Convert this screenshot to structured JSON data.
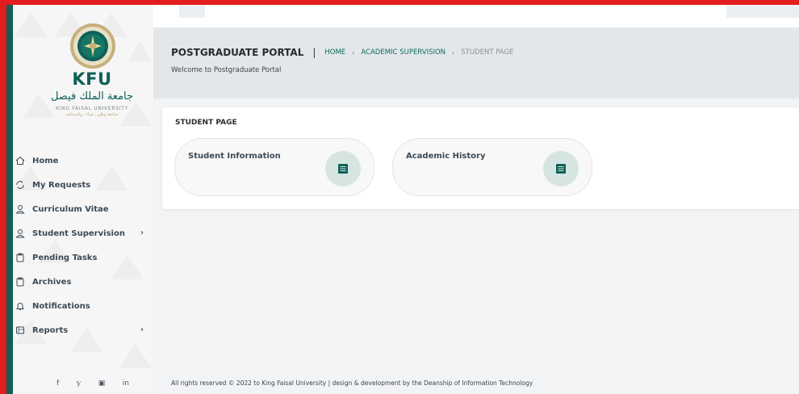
{
  "sidebar": {
    "logo": {
      "abbr": "KFU",
      "arabic_name": "جامعة الملك فيصل",
      "english_name": "KING FAISAL UNIVERSITY",
      "motto": "جـامعة وطن ـ نمـاء ـ واسـتدامة"
    },
    "items": [
      {
        "label": "Home",
        "icon": "home-icon"
      },
      {
        "label": "My Requests",
        "icon": "refresh-icon"
      },
      {
        "label": "Curriculum Vitae",
        "icon": "user-icon"
      },
      {
        "label": "Student Supervision",
        "icon": "user-icon",
        "chevron": "›"
      },
      {
        "label": "Pending Tasks",
        "icon": "clipboard-icon"
      },
      {
        "label": "Archives",
        "icon": "clipboard-icon"
      },
      {
        "label": "Notifications",
        "icon": "bell-icon"
      },
      {
        "label": "Reports",
        "icon": "report-icon",
        "chevron": "›"
      }
    ],
    "social": {
      "facebook": "f",
      "twitter": "𝕪",
      "youtube": "▣",
      "linkedin": "in"
    }
  },
  "header": {
    "title": "POSTGRADUATE PORTAL",
    "separator": "|",
    "breadcrumb": {
      "home": "HOME",
      "arrow": "›",
      "section": "ACADEMIC SUPERVISION",
      "current": "STUDENT PAGE"
    },
    "welcome": "Welcome to Postgraduate Portal"
  },
  "card": {
    "title": "STUDENT PAGE",
    "tiles": [
      {
        "label": "Student Information",
        "icon": "list-icon"
      },
      {
        "label": "Academic History",
        "icon": "list-icon"
      }
    ]
  },
  "footer": {
    "text": "All rights reserved © 2022 to King Faisal University | design & development by the Deanship of Information Technology"
  },
  "colors": {
    "accent": "#0e6157",
    "frame": "#e21d1d",
    "header_bg": "#e3e7ea"
  }
}
